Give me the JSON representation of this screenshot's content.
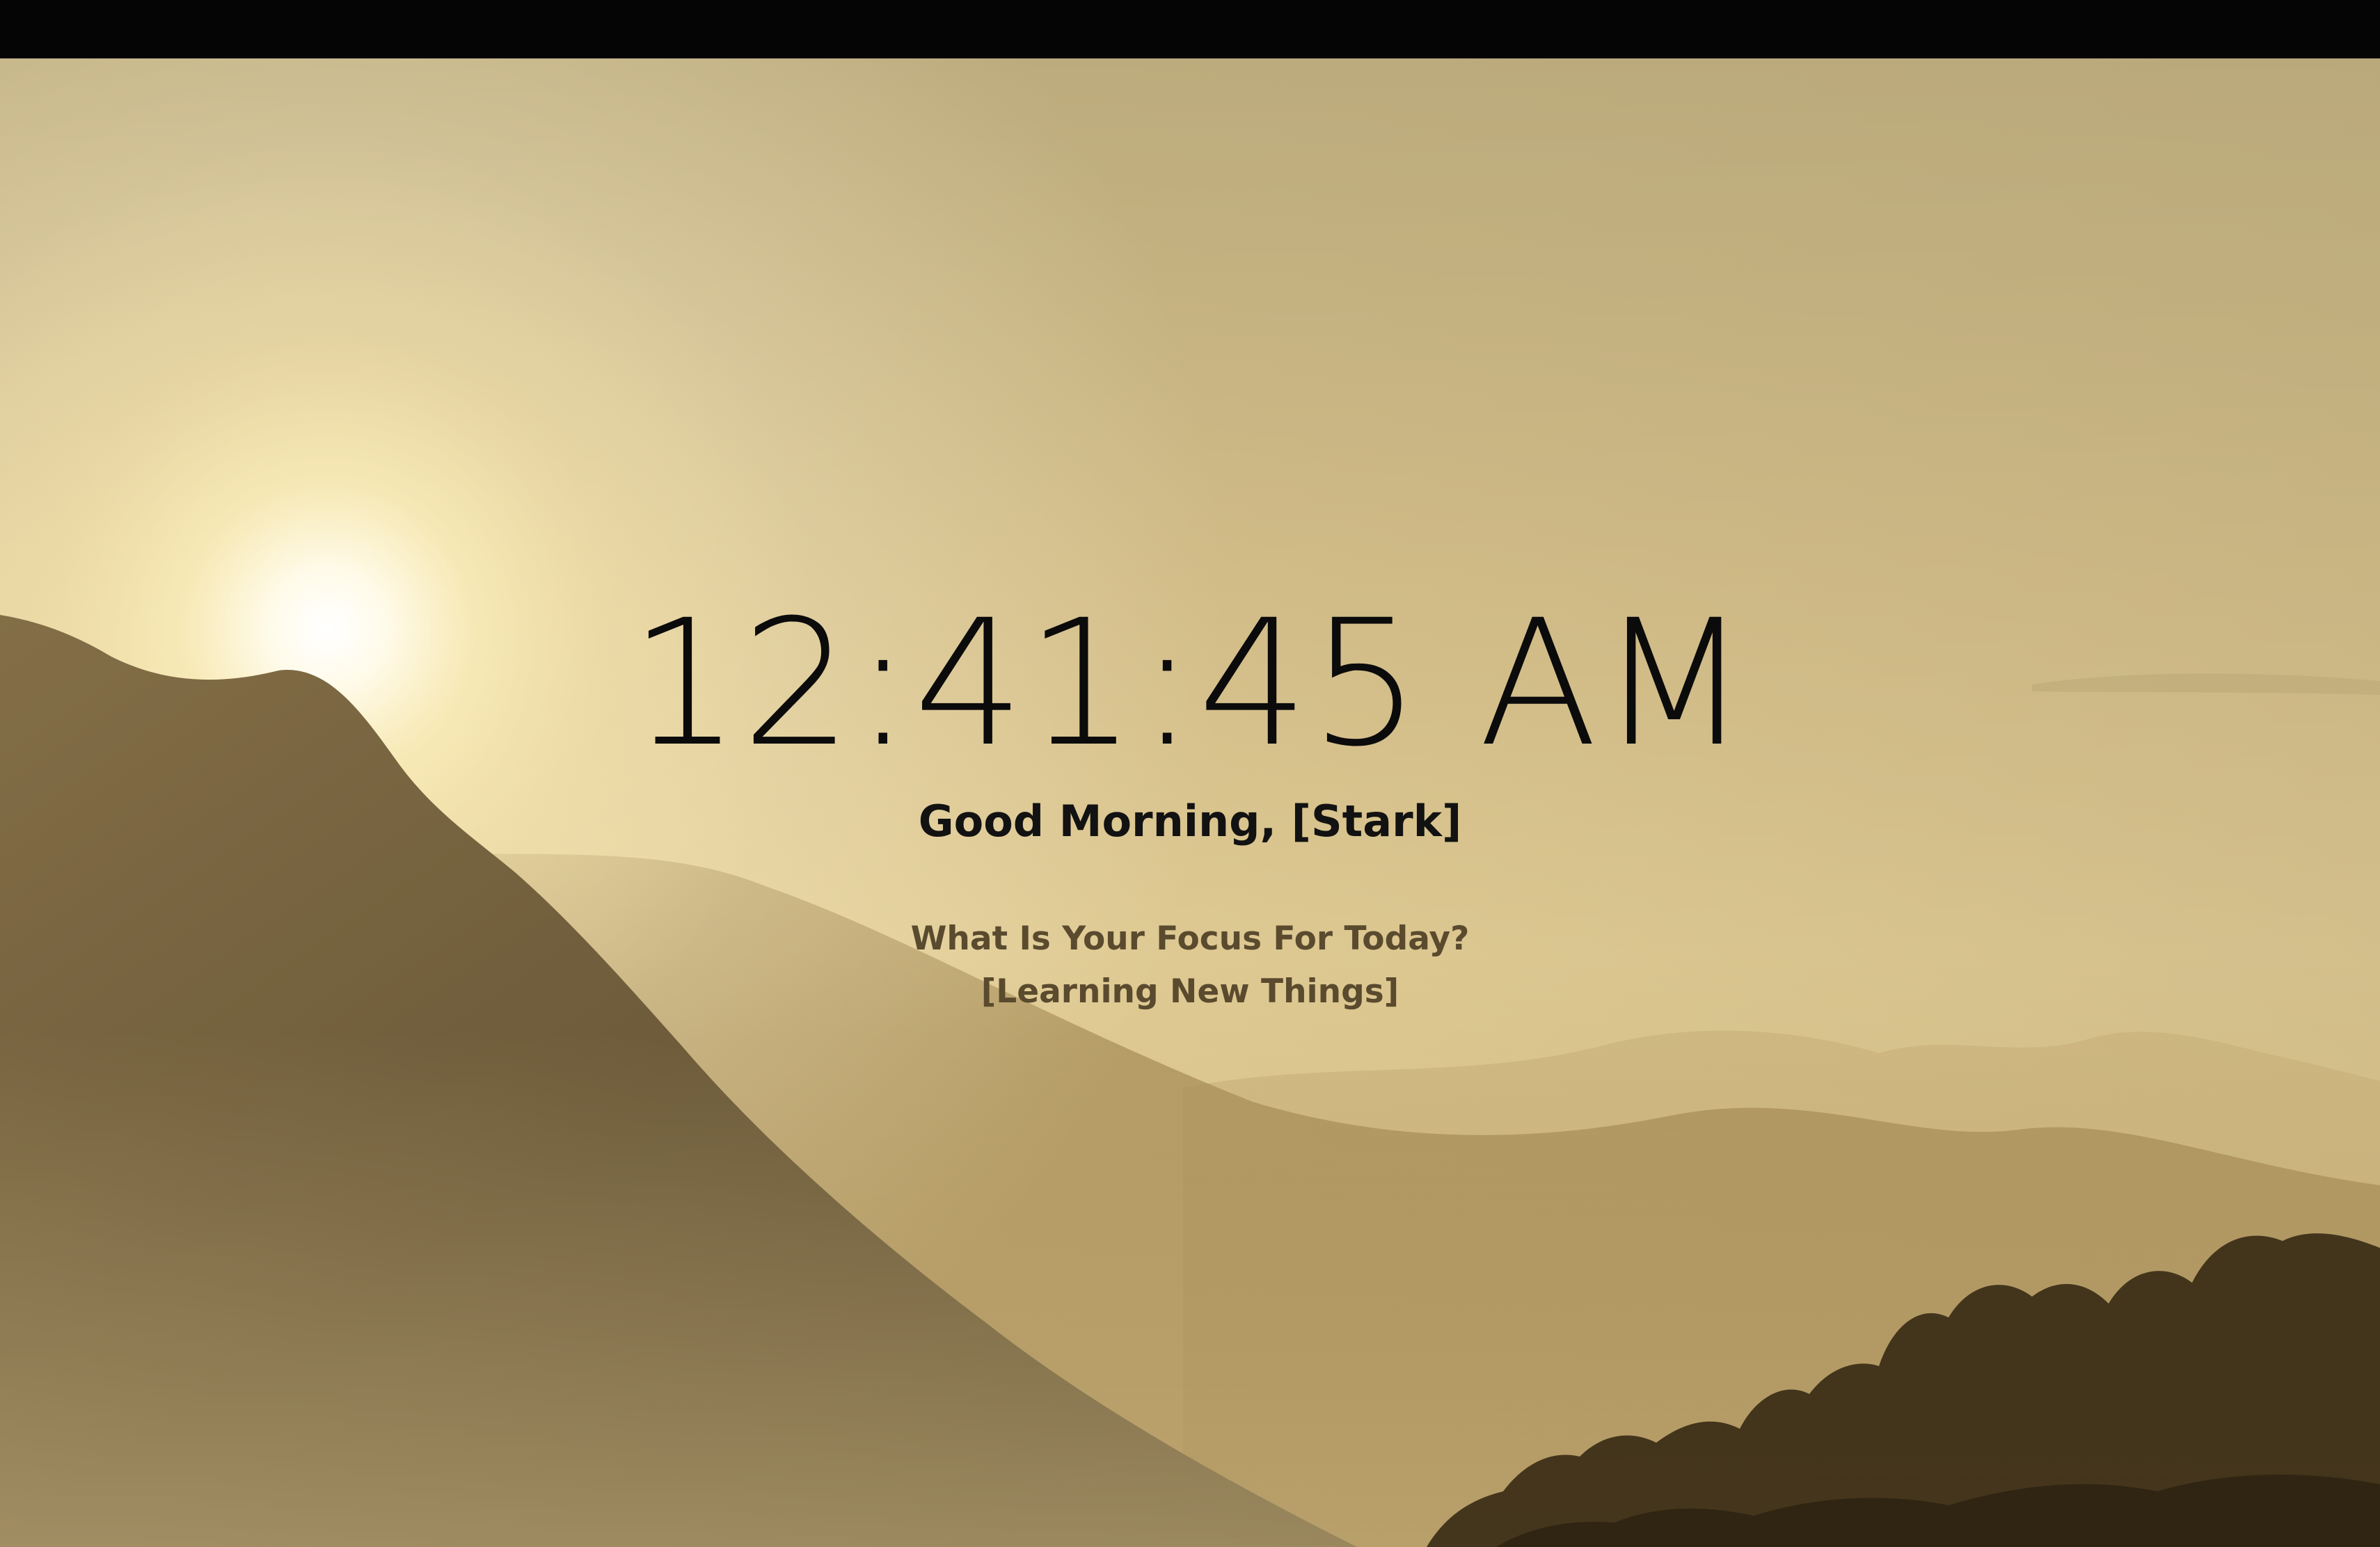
{
  "clock": {
    "time": "12:41:45 AM"
  },
  "greeting": {
    "text": "Good Morning, [Stark]"
  },
  "focus": {
    "question": "What Is Your Focus For Today?",
    "answer": "[Learning New Things]"
  }
}
